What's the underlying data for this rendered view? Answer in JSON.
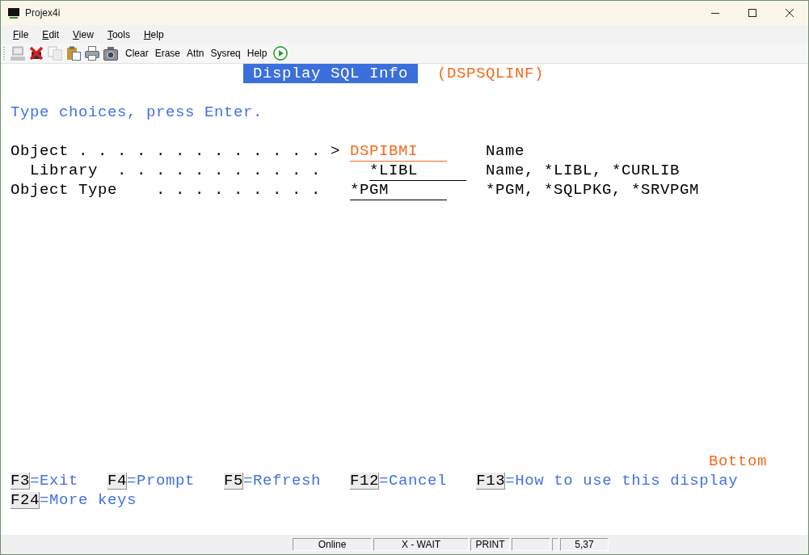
{
  "window": {
    "title": "Projex4i"
  },
  "menu": [
    "File",
    "Edit",
    "View",
    "Tools",
    "Help"
  ],
  "toolbar": {
    "items": [
      {
        "kind": "connect",
        "disabled": true
      },
      {
        "kind": "disconnect",
        "disabled": false
      },
      {
        "kind": "copy",
        "disabled": true
      },
      {
        "kind": "paste",
        "disabled": false
      },
      {
        "kind": "print",
        "disabled": false
      },
      {
        "kind": "snapshot",
        "disabled": false
      },
      {
        "kind": "text",
        "label": "Clear",
        "disabled": false
      },
      {
        "kind": "text",
        "label": "Erase",
        "disabled": false
      },
      {
        "kind": "text",
        "label": "Attn",
        "disabled": false
      },
      {
        "kind": "text",
        "label": "Sysreq",
        "disabled": false
      },
      {
        "kind": "text",
        "label": "Help",
        "disabled": false
      },
      {
        "kind": "play",
        "disabled": false
      }
    ]
  },
  "screen": {
    "title": "Display SQL Info",
    "command": "(DSPSQLINF)",
    "instruction": "Type choices, press Enter.",
    "fields": [
      {
        "label": "Object",
        "leader": ". . . . . . . . . . . . .",
        "marker": ">",
        "value": "DSPIBMI",
        "hint": "Name",
        "focused": true,
        "children": [
          {
            "label": "Library",
            "leader": ". . . . . . . . . . .",
            "value": "*LIBL",
            "hint": "Name, *LIBL, *CURLIB",
            "focused": false
          }
        ]
      },
      {
        "label": "Object Type",
        "leader": ". . . . . . . . .",
        "value": "*PGM",
        "hint": "*PGM, *SQLPKG, *SRVPGM",
        "focused": false
      }
    ],
    "more_indicator": "Bottom",
    "function_key_rows": [
      {
        "keys": [
          {
            "key": "F3",
            "label": "=Exit"
          },
          {
            "key": "F4",
            "label": "=Prompt"
          },
          {
            "key": "F5",
            "label": "=Refresh"
          },
          {
            "key": "F12",
            "label": "=Cancel"
          },
          {
            "key": "F13",
            "label": "=How to use this display"
          }
        ]
      },
      {
        "keys": [
          {
            "key": "F24",
            "label": "=More keys"
          }
        ]
      }
    ]
  },
  "status_bar": {
    "panels": [
      {
        "kind": "text",
        "text": "Online"
      },
      {
        "kind": "text",
        "text": "X - WAIT"
      },
      {
        "kind": "text",
        "text": "PRINT"
      },
      {
        "kind": "blank"
      },
      {
        "kind": "blank"
      },
      {
        "kind": "text",
        "text": "5,37"
      }
    ]
  }
}
